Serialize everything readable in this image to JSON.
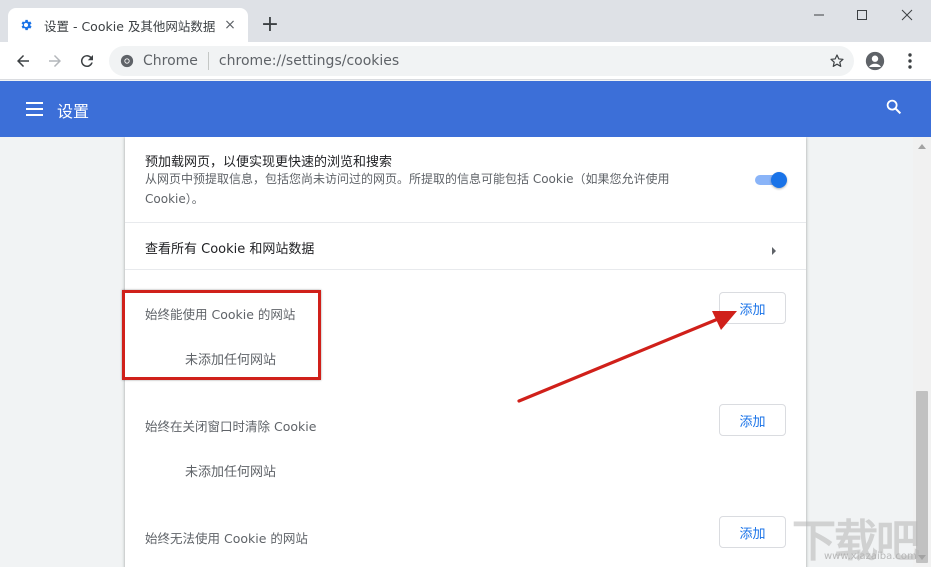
{
  "browser": {
    "tab_title": "设置 - Cookie 及其他网站数据",
    "tab_close_glyph": "×",
    "new_tab_glyph": "+",
    "omnibox_scheme": "Chrome",
    "omnibox_url": "chrome://settings/cookies"
  },
  "header": {
    "title": "设置"
  },
  "settings": {
    "preload": {
      "title": "预加载网页，以便实现更快速的浏览和搜索",
      "description": "从网页中预提取信息，包括您尚未访问过的网页。所提取的信息可能包括 Cookie（如果您允许使用 Cookie）。",
      "enabled": true
    },
    "see_all_label": "查看所有 Cookie 和网站数据",
    "sections": [
      {
        "label": "始终能使用 Cookie 的网站",
        "empty_text": "未添加任何网站",
        "add_label": "添加"
      },
      {
        "label": "始终在关闭窗口时清除 Cookie",
        "empty_text": "未添加任何网站",
        "add_label": "添加"
      },
      {
        "label": "始终无法使用 Cookie 的网站",
        "add_label": "添加"
      }
    ]
  },
  "watermark": {
    "text": "下载吧",
    "sub": "www.xiazaiba.com"
  },
  "colors": {
    "header_blue": "#3c6fd8",
    "accent_blue": "#1a73e8",
    "annotation_red": "#d0201a"
  }
}
